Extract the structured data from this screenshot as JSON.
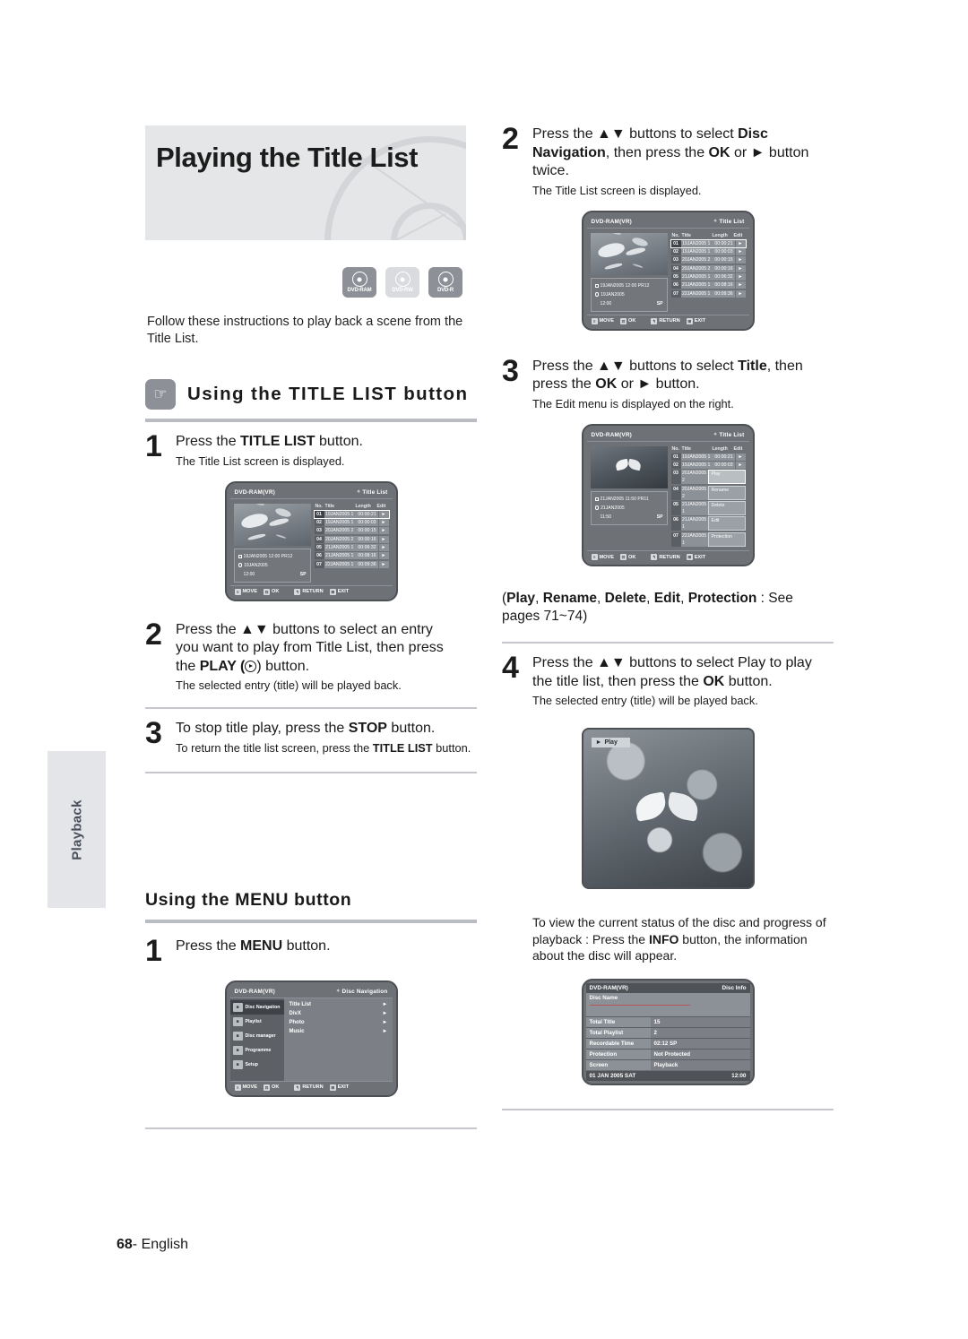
{
  "page": {
    "number": "68",
    "language": "English",
    "side_tab": "Playback"
  },
  "banner": {
    "title": "Playing the Title List"
  },
  "media_logos": [
    {
      "label": "DVD-RAM",
      "style": "dark"
    },
    {
      "label": "DVD-RW",
      "style": "light"
    },
    {
      "label": "DVD-R",
      "style": "dark"
    }
  ],
  "intro": "Follow these instructions to play back a scene from the Title List.",
  "sections": {
    "title_list": {
      "heading": "Using the TITLE LIST button",
      "icon": "hand-press-icon",
      "steps": [
        {
          "num": "1",
          "main_prefix": "Press the ",
          "main_bold": "TITLE LIST",
          "main_suffix": " button.",
          "sub": "The Title List screen is displayed."
        },
        {
          "num": "2",
          "main_line1": "Press the ▲▼ buttons to select an entry",
          "main_line2": "you want to play from Title List, then press",
          "main_line3_prefix": "the ",
          "main_line3_bold": "PLAY (",
          "main_line3_suffix": ") button.",
          "sub": "The selected entry (title) will be played back."
        },
        {
          "num": "3",
          "main_prefix": "To stop title play, press the ",
          "main_bold": "STOP",
          "main_suffix": " button.",
          "sub_prefix": "To return the title list screen, press the ",
          "sub_bold": "TITLE LIST",
          "sub_suffix": " button."
        }
      ]
    },
    "menu": {
      "heading": "Using the MENU button",
      "steps": [
        {
          "num": "1",
          "main_prefix": "Press the ",
          "main_bold": "MENU",
          "main_suffix": " button."
        }
      ]
    }
  },
  "right_column": {
    "steps": [
      {
        "num": "2",
        "line1_prefix": "Press the ▲▼ buttons to select ",
        "line1_bold": "Disc",
        "line2_bold": "Navigation",
        "line2_mid": ", then press the ",
        "line2_bold2": "OK",
        "line2_mid2": " or ► button",
        "line3": "twice.",
        "sub": "The Title List screen is displayed."
      },
      {
        "num": "3",
        "line1_prefix": "Press the ▲▼ buttons to select ",
        "line1_bold": "Title",
        "line1_suffix": ", then",
        "line2_prefix": "press the ",
        "line2_bold": "OK",
        "line2_suffix": " or ► button.",
        "sub": "The Edit menu is displayed on the right."
      },
      {
        "num": "4",
        "line1": "Press the ▲▼ buttons to select Play to play",
        "line2_prefix": "the title list, then press the ",
        "line2_bold": "OK",
        "line2_suffix": " button.",
        "sub": "The selected entry (title) will be played back."
      }
    ],
    "edit_note": {
      "open": "(",
      "items": [
        "Play",
        "Rename",
        "Delete",
        "Edit",
        "Protection"
      ],
      "tail": " : See pages 71~74)"
    },
    "info_note": {
      "line1": "To view the current status of the disc and progress of",
      "line2_prefix": "playback : Press the ",
      "line2_bold": "INFO",
      "line2_suffix": " button, the information",
      "line3": "about the disc will appear."
    }
  },
  "osd": {
    "common_footer": [
      {
        "key": "≡",
        "label": "MOVE"
      },
      {
        "key": "⊡",
        "label": "OK"
      },
      {
        "key": "↰",
        "label": "RETURN"
      },
      {
        "key": "⊞",
        "label": "EXIT"
      }
    ],
    "title_list_screen": {
      "disc_type": "DVD-RAM(VR)",
      "screen_title": "Title List",
      "columns": {
        "no": "No.",
        "title": "Title",
        "length": "Length",
        "edit": "Edit"
      },
      "rows": [
        {
          "no": "01",
          "title": "19JAN2005 1",
          "length": "00:00:21",
          "edit": "►",
          "selected": true
        },
        {
          "no": "02",
          "title": "19JAN2005 1",
          "length": "00:00:03",
          "edit": "►",
          "selected": false
        },
        {
          "no": "03",
          "title": "20JAN2005 2",
          "length": "00:00:15",
          "edit": "►",
          "selected": false
        },
        {
          "no": "04",
          "title": "20JAN2005 2",
          "length": "00:00:16",
          "edit": "►",
          "selected": false
        },
        {
          "no": "05",
          "title": "21JAN2005 1",
          "length": "00:06:32",
          "edit": "►",
          "selected": false
        },
        {
          "no": "06",
          "title": "21JAN2005 1",
          "length": "00:08:16",
          "edit": "►",
          "selected": false
        },
        {
          "no": "07",
          "title": "22JAN2005 1",
          "length": "00:09:36",
          "edit": "►",
          "selected": false
        }
      ],
      "info": {
        "title": "19JAN2005 12:00 PR12",
        "date": "19JAN2005",
        "time": "12:00",
        "mode": "SP"
      }
    },
    "edit_menu_screen": {
      "disc_type": "DVD-RAM(VR)",
      "screen_title": "Title List",
      "columns": {
        "no": "No.",
        "title": "Title",
        "length": "Length",
        "edit": "Edit"
      },
      "rows": [
        {
          "no": "01",
          "title": "19JAN2005 1",
          "length": "00:00:21",
          "edit": "►"
        },
        {
          "no": "02",
          "title": "19JAN2005 1",
          "length": "00:00:03",
          "edit": "►"
        },
        {
          "no": "03",
          "title": "20JAN2005 2",
          "length": "",
          "edit": ""
        },
        {
          "no": "04",
          "title": "20JAN2005 2",
          "length": "",
          "edit": ""
        },
        {
          "no": "05",
          "title": "21JAN2005 1",
          "length": "",
          "edit": ""
        },
        {
          "no": "06",
          "title": "21JAN2005 1",
          "length": "",
          "edit": ""
        },
        {
          "no": "07",
          "title": "22JAN2005 1",
          "length": "",
          "edit": ""
        }
      ],
      "edit_menu": [
        "Play",
        "Rename",
        "Delete",
        "Edit",
        "Protection"
      ],
      "info": {
        "title": "21JAN2005 11:50 PR11",
        "date": "21JAN2005",
        "time": "11:50",
        "mode": "SP"
      }
    },
    "disc_navigation_screen": {
      "disc_type": "DVD-RAM(VR)",
      "screen_title": "Disc Navigation",
      "sidebar": [
        {
          "label": "Disc Navigation",
          "icon": "film-icon",
          "active": true
        },
        {
          "label": "Playlist",
          "icon": "list-icon",
          "active": false
        },
        {
          "label": "Disc manager",
          "icon": "disc-icon",
          "active": false
        },
        {
          "label": "Programme",
          "icon": "calendar-icon",
          "active": false
        },
        {
          "label": "Setup",
          "icon": "gear-icon",
          "active": false
        }
      ],
      "items": [
        "Title List",
        "DivX",
        "Photo",
        "Music"
      ]
    },
    "disc_info_screen": {
      "disc_type": "DVD-RAM(VR)",
      "screen_title": "Disc Info",
      "disc_name_label": "Disc Name",
      "rows": [
        {
          "key": "Total Title",
          "value": "15"
        },
        {
          "key": "Total Playlist",
          "value": "2"
        },
        {
          "key": "Recordable Time",
          "value": "02:12  SP"
        },
        {
          "key": "Protection",
          "value": "Not Protected"
        },
        {
          "key": "Screen",
          "value": "Playback"
        }
      ],
      "footer_date": "01 JAN 2005 SAT",
      "footer_time": "12:00"
    },
    "play_screen": {
      "badge": "Play",
      "badge_icon": "play-triangle-icon"
    }
  }
}
